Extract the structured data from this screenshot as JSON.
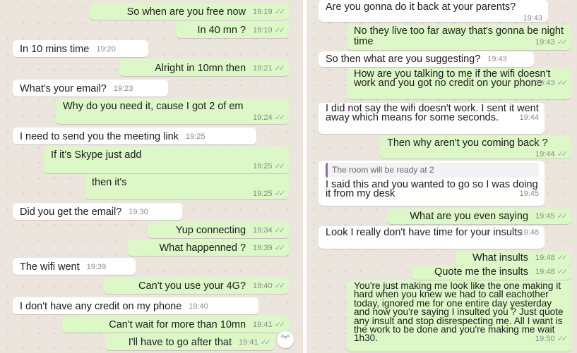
{
  "left": {
    "messages": [
      {
        "side": "out",
        "text": "So when are you free now",
        "time": "19:19"
      },
      {
        "side": "out",
        "text": "In 40 mn ?",
        "time": "19:19"
      },
      {
        "side": "in",
        "text": "In 10 mins time",
        "time": "19:20"
      },
      {
        "side": "out",
        "text": "Alright in 10mn then",
        "time": "19:21"
      },
      {
        "side": "in",
        "text": "What's your email?",
        "time": "19:23"
      },
      {
        "side": "out",
        "text": "Why do you need it, cause I got 2 of em",
        "time": "19:24"
      },
      {
        "side": "in",
        "text": "I need to send you the meeting link",
        "time": "19:25"
      },
      {
        "side": "out",
        "text": "If it's Skype just add",
        "time": "19:25"
      },
      {
        "side": "out",
        "text": "then it's",
        "time": "19:25"
      },
      {
        "side": "in",
        "text": "Did you get the email?",
        "time": "19:30"
      },
      {
        "side": "out",
        "text": "Yup connecting",
        "time": "19:34"
      },
      {
        "side": "out",
        "text": "What happenned ?",
        "time": "19:39"
      },
      {
        "side": "in",
        "text": "The wifi went",
        "time": "19:39"
      },
      {
        "side": "out",
        "text": "Can't you use your 4G?",
        "time": "19:40"
      },
      {
        "side": "in",
        "text": "I don't have any credit on my phone",
        "time": "19:40"
      },
      {
        "side": "out",
        "text": "Can't wait for more than 10mn",
        "time": "19:41"
      },
      {
        "side": "out",
        "text": "I'll have to go after that",
        "time": "19:41"
      }
    ],
    "scroll_icon": "double-chevron-down-icon"
  },
  "right": {
    "messages": [
      {
        "side": "in",
        "text": "Are you gonna do it back at your parents?",
        "time": "19:43"
      },
      {
        "side": "out",
        "text": "No they live too far away that's gonna be night time",
        "time": "19:43"
      },
      {
        "side": "in",
        "text": "So then what are you suggesting?",
        "time": "19:43"
      },
      {
        "side": "out",
        "text": "How are you talking to me if the wifi doesn't work and you got no credit on your phone",
        "time": "19:43"
      },
      {
        "side": "in",
        "text": "I did not say the wifi doesn't work. I sent it went away which means for some seconds.",
        "time": "19:44"
      },
      {
        "side": "out",
        "text": "Then why aren't you coming back ?",
        "time": "19:44"
      },
      {
        "side": "in",
        "quote": "The room will be ready at 2",
        "text": "I said this and you wanted to go so I was doing it from my desk",
        "time": "19:45"
      },
      {
        "side": "out",
        "text": "What are you even saying",
        "time": "19:45"
      },
      {
        "side": "in",
        "text": "Look I really don't have time for your insults",
        "time": "19:48"
      },
      {
        "side": "out",
        "text": "What insults",
        "time": "19:48"
      },
      {
        "side": "out",
        "text": "Quote me the insults",
        "time": "19:48"
      },
      {
        "side": "out",
        "text": "You're just making me look like the one making it hard when you knew we had to call eachother today, ignored me for one entire day yesterday and now you're saying I insulted you ? Just quote any insult and stop disrespecting me. All I want is the work to be done and you're making me wait 1h30.",
        "time": "19:50"
      }
    ]
  },
  "colors": {
    "outgoing": "#dcf8c6",
    "incoming": "#ffffff",
    "background": "#ece5dd",
    "ticks": "#9aa"
  }
}
